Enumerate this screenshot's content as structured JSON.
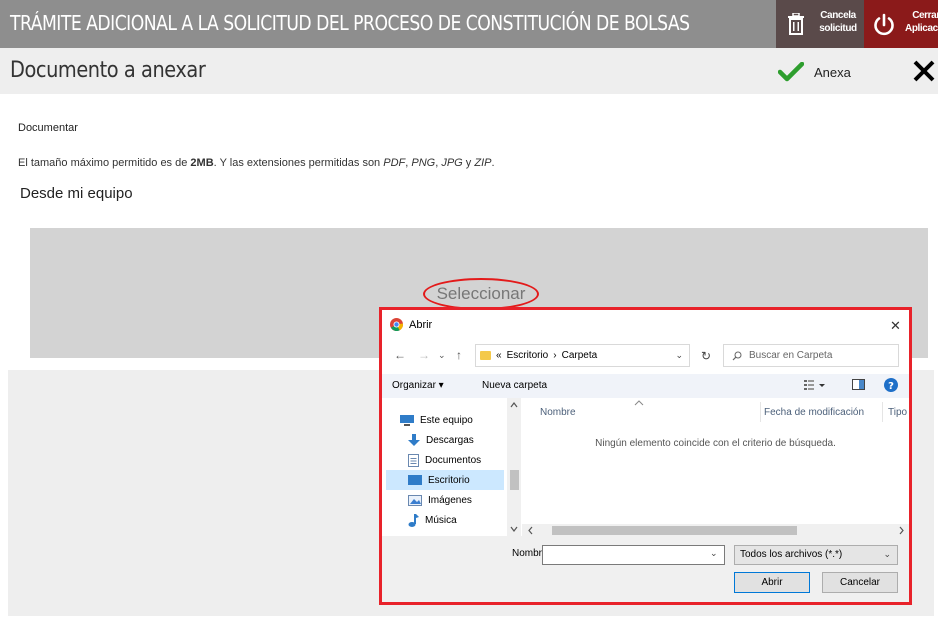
{
  "header": {
    "title": "TRÁMITE ADICIONAL A LA SOLICITUD DEL PROCESO DE CONSTITUCIÓN DE BOLSAS",
    "cancel_line1": "Cancela",
    "cancel_line2": "solicitud",
    "close_line1": "Cerrar",
    "close_line2": "Aplicación"
  },
  "subheader": {
    "title": "Documento a anexar",
    "anexa_label": "Anexa"
  },
  "content": {
    "documentar_label": "Documentar",
    "info_prefix": "El tamaño máximo permitido es de ",
    "info_size": "2MB",
    "info_mid": ". Y las extensiones permitidas son ",
    "ext1": "PDF",
    "sep1": ", ",
    "ext2": "PNG",
    "sep2": ", ",
    "ext3": "JPG",
    "sep3": " y ",
    "ext4": "ZIP",
    "info_end": ".",
    "desde_label": "Desde mi equipo",
    "select_label": "Seleccionar"
  },
  "dialog": {
    "title": "Abrir",
    "breadcrumb_prefix": "«",
    "crumb1": "Escritorio",
    "crumb_sep": "›",
    "crumb2": "Carpeta",
    "search_placeholder": "Buscar en Carpeta",
    "organize_label": "Organizar ▾",
    "new_folder_label": "Nueva carpeta",
    "nav_items": [
      {
        "label": "Este equipo",
        "icon": "computer-icon"
      },
      {
        "label": "Descargas",
        "icon": "download-icon"
      },
      {
        "label": "Documentos",
        "icon": "documents-icon"
      },
      {
        "label": "Escritorio",
        "icon": "desktop-icon"
      },
      {
        "label": "Imágenes",
        "icon": "images-icon"
      },
      {
        "label": "Música",
        "icon": "music-icon"
      }
    ],
    "columns": [
      "Nombre",
      "Fecha de modificación",
      "Tipo"
    ],
    "empty_message": "Ningún elemento coincide con el criterio de búsqueda.",
    "filename_label": "Nombre:",
    "filename_value": "",
    "filter_value": "Todos los archivos (*.*)",
    "open_button": "Abrir",
    "cancel_button": "Cancelar"
  },
  "colors": {
    "header_bg": "#8e8e8e",
    "cancel_bg": "#5a4a4a",
    "close_bg": "#8b1a1a",
    "highlight": "#e31a1a",
    "check_green": "#2e9e2e",
    "selected_nav": "#cce8ff"
  }
}
